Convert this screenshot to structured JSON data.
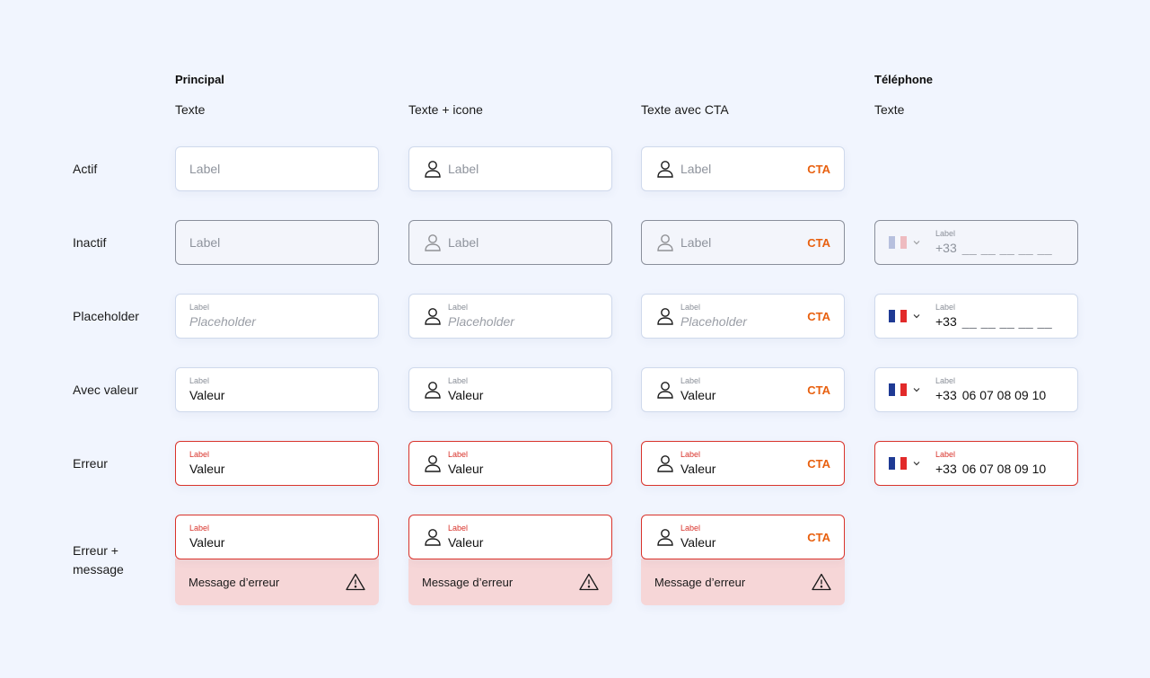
{
  "headings": {
    "principal": "Principal",
    "telephone": "Téléphone",
    "col_texte": "Texte",
    "col_texte_icone": "Texte + icone",
    "col_texte_cta": "Texte avec CTA",
    "col_tel_texte": "Texte"
  },
  "rows": {
    "actif": "Actif",
    "inactif": "Inactif",
    "placeholder": "Placeholder",
    "avec_valeur": "Avec valeur",
    "erreur": "Erreur",
    "erreur_message_line1": "Erreur +",
    "erreur_message_line2": "message"
  },
  "field": {
    "label": "Label",
    "placeholder": "Placeholder",
    "value": "Valeur",
    "cta": "CTA",
    "error_message": "Message d’erreur"
  },
  "phone": {
    "prefix": "+33",
    "blanks": "__ __ __ __ __",
    "number": "06 07 08 09 10",
    "country": "FR",
    "flag_colors": [
      "#1f3a94",
      "#ffffff",
      "#e22a2a"
    ]
  },
  "icons": {
    "user": "user-icon",
    "chevron": "chevron-down-icon",
    "warning": "warning-icon",
    "flag": "flag-fr-icon"
  },
  "colors": {
    "background": "#f1f5fe",
    "border": "#cfd9ec",
    "error": "#d9332b",
    "cta": "#e8600f",
    "error_message_bg": "#f6d6d7"
  }
}
